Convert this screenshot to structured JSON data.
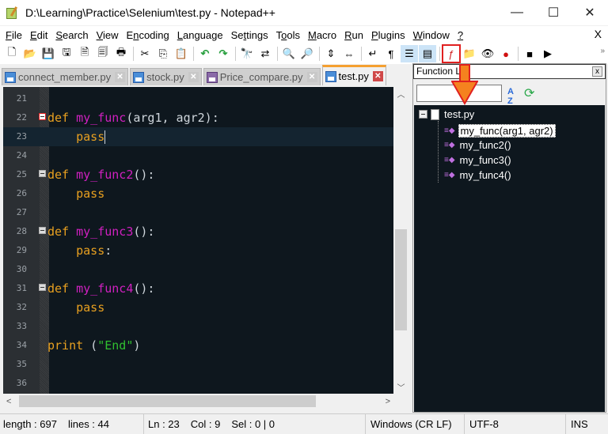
{
  "window": {
    "title": "D:\\Learning\\Practice\\Selenium\\test.py - Notepad++",
    "minimize": "—",
    "maximize": "☐",
    "close": "✕"
  },
  "menu": {
    "items": [
      {
        "key": "F",
        "rest": "ile"
      },
      {
        "key": "E",
        "rest": "dit"
      },
      {
        "key": "S",
        "rest": "earch"
      },
      {
        "key": "V",
        "rest": "iew"
      },
      {
        "pre": "E",
        "key": "n",
        "rest": "coding"
      },
      {
        "key": "L",
        "rest": "anguage"
      },
      {
        "pre": "Se",
        "key": "t",
        "rest": "tings"
      },
      {
        "pre": "T",
        "key": "o",
        "rest": "ols"
      },
      {
        "key": "M",
        "rest": "acro"
      },
      {
        "key": "R",
        "rest": "un"
      },
      {
        "key": "P",
        "rest": "lugins"
      },
      {
        "key": "W",
        "rest": "indow"
      },
      {
        "key": "?",
        "rest": ""
      }
    ],
    "close_doc": "X"
  },
  "toolbar": {
    "icons": [
      "new-file",
      "open-file",
      "save",
      "save-all",
      "close",
      "close-all",
      "print",
      "cut",
      "copy",
      "paste",
      "undo",
      "redo",
      "find",
      "replace",
      "zoom-in",
      "zoom-out",
      "sync-vertical",
      "sync-horizontal",
      "word-wrap",
      "show-all-chars",
      "indent-guide",
      "document-map",
      "function-list",
      "folder-as-workspace",
      "monitoring",
      "record-macro",
      "stop-macro",
      "play-macro"
    ],
    "more": "»"
  },
  "tabs": [
    {
      "label": "connect_member.py",
      "color": "#4a8ed8",
      "active": false
    },
    {
      "label": "stock.py",
      "color": "#4a8ed8",
      "active": false
    },
    {
      "label": "Price_compare.py",
      "color": "#8a6aa8",
      "active": false
    },
    {
      "label": "test.py",
      "color": "#4a8ed8",
      "active": true
    }
  ],
  "editor": {
    "lines": [
      {
        "n": "21"
      },
      {
        "n": "22",
        "def": "def",
        "name": "my_func",
        "rest": "(arg1, agr2):",
        "fold": "red"
      },
      {
        "n": "23",
        "body": "pass",
        "current": true
      },
      {
        "n": "24"
      },
      {
        "n": "25",
        "def": "def",
        "name": "my_func2",
        "rest": "():",
        "fold": "gray"
      },
      {
        "n": "26",
        "body": "pass"
      },
      {
        "n": "27"
      },
      {
        "n": "28",
        "def": "def",
        "name": "my_func3",
        "rest": "():",
        "fold": "gray"
      },
      {
        "n": "29",
        "body": "pass",
        "bodyrest": ":"
      },
      {
        "n": "30"
      },
      {
        "n": "31",
        "def": "def",
        "name": "my_func4",
        "rest": "():",
        "fold": "gray"
      },
      {
        "n": "32",
        "body": "pass"
      },
      {
        "n": "33"
      },
      {
        "n": "34",
        "print": "print",
        "p1": " (",
        "str": "\"End\"",
        "p2": ")"
      },
      {
        "n": "35"
      },
      {
        "n": "36"
      }
    ]
  },
  "function_list": {
    "title": "Function List",
    "close": "x",
    "search_value": "",
    "sort_icon": "A↓Z",
    "root": "test.py",
    "items": [
      {
        "label": "my_func(arg1, agr2)",
        "selected": true
      },
      {
        "label": "my_func2()",
        "selected": false
      },
      {
        "label": "my_func3()",
        "selected": false
      },
      {
        "label": "my_func4()",
        "selected": false
      }
    ]
  },
  "annotation": {
    "color": "#e02020",
    "arrow_fill": "#f5821f"
  },
  "status": {
    "length": "length : 697",
    "lines": "lines : 44",
    "ln": "Ln : 23",
    "col": "Col : 9",
    "sel": "Sel : 0 | 0",
    "eol": "Windows (CR LF)",
    "encoding": "UTF-8",
    "mode": "INS"
  }
}
